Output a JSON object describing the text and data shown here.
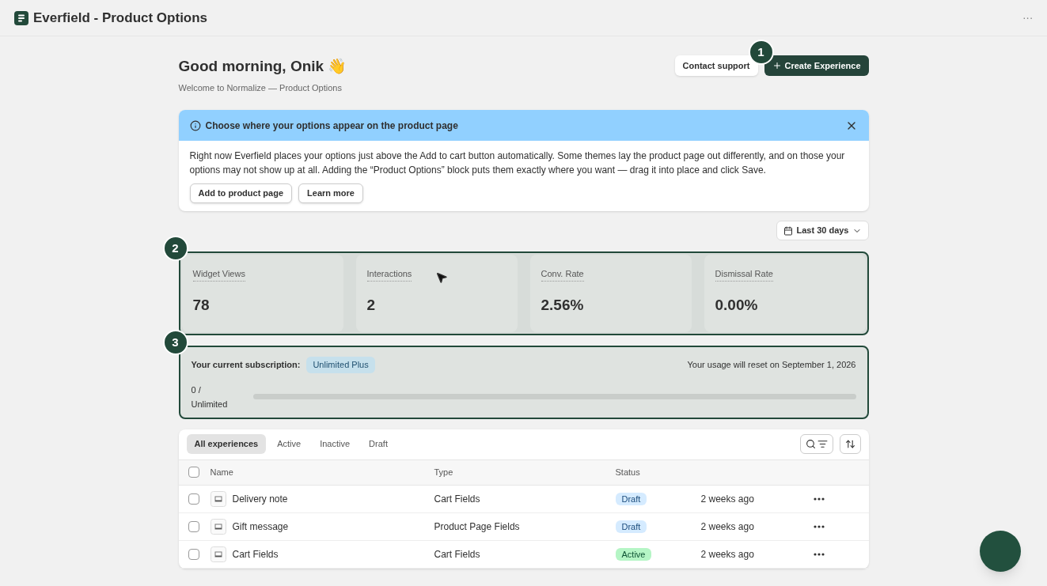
{
  "window": {
    "title": "Everfield - Product Options",
    "menu": "···"
  },
  "header": {
    "greeting": "Good morning, Onik 👋",
    "subtitle": "Welcome to Normalize — Product Options",
    "buttons": [
      {
        "label": "Contact support",
        "kind": "secondary"
      },
      {
        "label": "Create Experience",
        "kind": "primary"
      }
    ]
  },
  "banner": {
    "title": "Choose where your options appear on the product page",
    "body": "Right now Everfield places your options just above the Add to cart button automatically. Some themes lay the product page out differently, and on those your options may not show up at all. Adding the “Product Options” block puts them exactly where you want — drag it into place and click Save.",
    "buttons": [
      "Add to product page",
      "Learn more"
    ]
  },
  "date_range": "Last 30 days",
  "markers": [
    "1",
    "2",
    "3"
  ],
  "metrics": [
    {
      "label": "Widget Views",
      "value": "78"
    },
    {
      "label": "Interactions",
      "value": "2"
    },
    {
      "label": "Conv. Rate",
      "value": "2.56%"
    },
    {
      "label": "Dismissal Rate",
      "value": "0.00%"
    }
  ],
  "subscription": {
    "label": "Your current subscription:",
    "plan": "Unlimited Plus",
    "reset": "Your usage will reset on September 1, 2026",
    "usage": "0 / Unlimited",
    "level": 0
  },
  "table": {
    "tabs": [
      {
        "label": "All experiences",
        "selected": true
      },
      {
        "label": "Active",
        "selected": false
      },
      {
        "label": "Inactive",
        "selected": false
      },
      {
        "label": "Draft",
        "selected": false
      }
    ],
    "select_all_checked": false,
    "columns": [
      "Name",
      "Type",
      "Status"
    ],
    "rows": [
      {
        "checked": false,
        "name": "Delivery note",
        "type": "Cart Fields",
        "status": {
          "label": "Draft",
          "kind": "draft"
        },
        "time": "2 weeks ago"
      },
      {
        "checked": false,
        "name": "Gift message",
        "type": "Product Page Fields",
        "status": {
          "label": "Draft",
          "kind": "draft"
        },
        "time": "2 weeks ago"
      },
      {
        "checked": false,
        "name": "Cart Fields",
        "type": "Cart Fields",
        "status": {
          "label": "Active",
          "kind": "active"
        },
        "time": "2 weeks ago"
      }
    ]
  }
}
